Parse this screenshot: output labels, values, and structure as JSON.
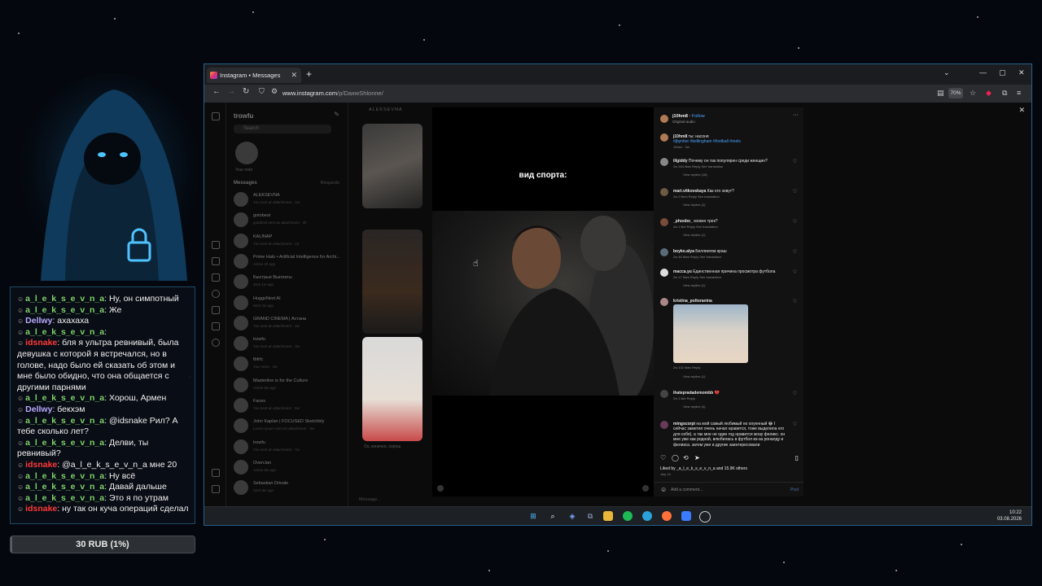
{
  "chat": {
    "messages": [
      {
        "user": "a_l_e_k_s_e_v_n_a",
        "color": "#7fd36a",
        "text": "Ну, он симпотный"
      },
      {
        "user": "a_l_e_k_s_e_v_n_a",
        "color": "#7fd36a",
        "text": "Же"
      },
      {
        "user": "Dellwy",
        "color": "#b8a9ff",
        "text": "ахахаха"
      },
      {
        "user": "a_l_e_k_s_e_v_n_a",
        "color": "#7fd36a",
        "text": ""
      },
      {
        "user": "idsnake",
        "color": "#ff3a3a",
        "text": "бля я ультра ревнивый, была девушка с которой я встречался, но в голове, надо было ей сказать об этом и мне было обидно, что она общается с другими парнями"
      },
      {
        "user": "a_l_e_k_s_e_v_n_a",
        "color": "#7fd36a",
        "text": "Хорош, Армен"
      },
      {
        "user": "Dellwy",
        "color": "#b8a9ff",
        "text": "бекхэм"
      },
      {
        "user": "a_l_e_k_s_e_v_n_a",
        "color": "#7fd36a",
        "text": "@idsnake Рил? А тебе сколько лет?"
      },
      {
        "user": "a_l_e_k_s_e_v_n_a",
        "color": "#7fd36a",
        "text": "Делви, ты ревнивый?"
      },
      {
        "user": "idsnake",
        "color": "#ff3a3a",
        "text": "@a_l_e_k_s_e_v_n_a мне 20"
      },
      {
        "user": "a_l_e_k_s_e_v_n_a",
        "color": "#7fd36a",
        "text": "Ну всё"
      },
      {
        "user": "a_l_e_k_s_e_v_n_a",
        "color": "#7fd36a",
        "text": "Давай дальше"
      },
      {
        "user": "a_l_e_k_s_e_v_n_a",
        "color": "#7fd36a",
        "text": "Это я по утрам"
      },
      {
        "user": "idsnake",
        "color": "#ff3a3a",
        "text": "ну так он куча операций сделал"
      }
    ],
    "donation": {
      "label": "30 RUB (1%)",
      "progress": 0.01
    }
  },
  "browser": {
    "tab_title": "Instagram • Messages",
    "url_host": "www.instagram.com",
    "url_path": "/p/DaxwShlonne/",
    "zoom": "70%"
  },
  "instagram": {
    "username": "trowfu",
    "search_placeholder": "Search",
    "note_label": "Your note",
    "messages_label": "Messages",
    "requests_label": "Requests",
    "conversations": [
      {
        "name": "ALEKSEVNA",
        "sub": "You sent an attachment · 1m"
      },
      {
        "name": "gotobest",
        "sub": "gotobest sent an attachment · 3h"
      },
      {
        "name": "KALINAP",
        "sub": "You sent an attachment · 1d"
      },
      {
        "name": "Prime Halo • Artificial Intelligence for Archi...",
        "sub": "Active 2h ago"
      },
      {
        "name": "Быстрые Выплаты",
        "sub": "Sent 1w ago"
      },
      {
        "name": "HuggsNext AI",
        "sub": "Sent 2w ago"
      },
      {
        "name": "GRAND CINEMA | Астана",
        "sub": "You sent an attachment · 2w"
      },
      {
        "name": "trowfu",
        "sub": "You sent an attachment · 3w"
      },
      {
        "name": "fbfrfc",
        "sub": "You: seen · 4w"
      },
      {
        "name": "Masterline is for the Culture",
        "sub": "Active 5w ago"
      },
      {
        "name": "Faces",
        "sub": "You sent an attachment · 5w"
      },
      {
        "name": "John Kaplan | FOCUSED Sketchbly",
        "sub": "Lorem ipsum sent an attachment · 6w"
      },
      {
        "name": "trowfu",
        "sub": "You sent an attachment · 7w"
      },
      {
        "name": "Overclan",
        "sub": "Active 8w ago"
      },
      {
        "name": "Sebastian Drivale",
        "sub": "Sent 9w ago"
      }
    ],
    "thread_header": "ALEKSEVNA",
    "thread_reply": "Ох, конечно, хорош",
    "message_placeholder": "Message..."
  },
  "reel": {
    "caption": "вид спорта:"
  },
  "post": {
    "author": "j10hm8",
    "follow": "Follow",
    "audio": "Original audio",
    "more": "···",
    "caption_user": "j10hm8",
    "caption_text": "ты: насоня",
    "caption_tags": "#jbynbor #bellingham #football #reels",
    "caption_meta": "1hhen · 2w",
    "comments": [
      {
        "user": "illgiddy",
        "text": "Почему он так популярен среди женщин?",
        "meta": "2w   164 likes   Reply   See translation",
        "replies": "View replies (18)"
      },
      {
        "user": "mari.vitkovskaya",
        "text": "Как его зовут?",
        "meta": "2w   2 likes   Reply   See translation",
        "replies": "View replies (2)"
      },
      {
        "user": "_phoobo_",
        "text": "можно трек?",
        "meta": "2w   1 like   Reply   See translation",
        "replies": "View replies (1)"
      },
      {
        "user": "boyko.alya",
        "text": "Беллингем краш",
        "meta": "2w   46 likes   Reply   See translation",
        "replies": ""
      },
      {
        "user": "macca.yu",
        "text": "Единственная причина просмотра футбола",
        "meta": "2w   17 likes   Reply   See translation",
        "replies": "View replies (1)"
      },
      {
        "user": "kristina_poltoranina",
        "text": "",
        "meta": "2w   102 likes   Reply",
        "replies": "View replies (1)"
      },
      {
        "user": "ihatepradademombb",
        "text": "💔",
        "meta": "2w   1 like   Reply",
        "replies": "View replies (4)"
      },
      {
        "user": "mingscorpi",
        "text": "на мой самый любимый но ооуенный 😂 I сейчас заметил очень начал нравится, тоже выделила его для себя). а так мне не один год нравится жоау феликс. он мне уже как родной, влюбилась в футбол из-за роналду и феликса. затем уже и другие заинтересовали",
        "meta": "",
        "replies": ""
      }
    ],
    "likes": "Liked by _a_l_e_k_s_e_v_n_a and 15.9K others",
    "date": "July 14",
    "add_comment": "Add a comment...",
    "post_button": "Post"
  },
  "taskbar": {
    "time": "10:22",
    "date": "03.08.2026"
  }
}
